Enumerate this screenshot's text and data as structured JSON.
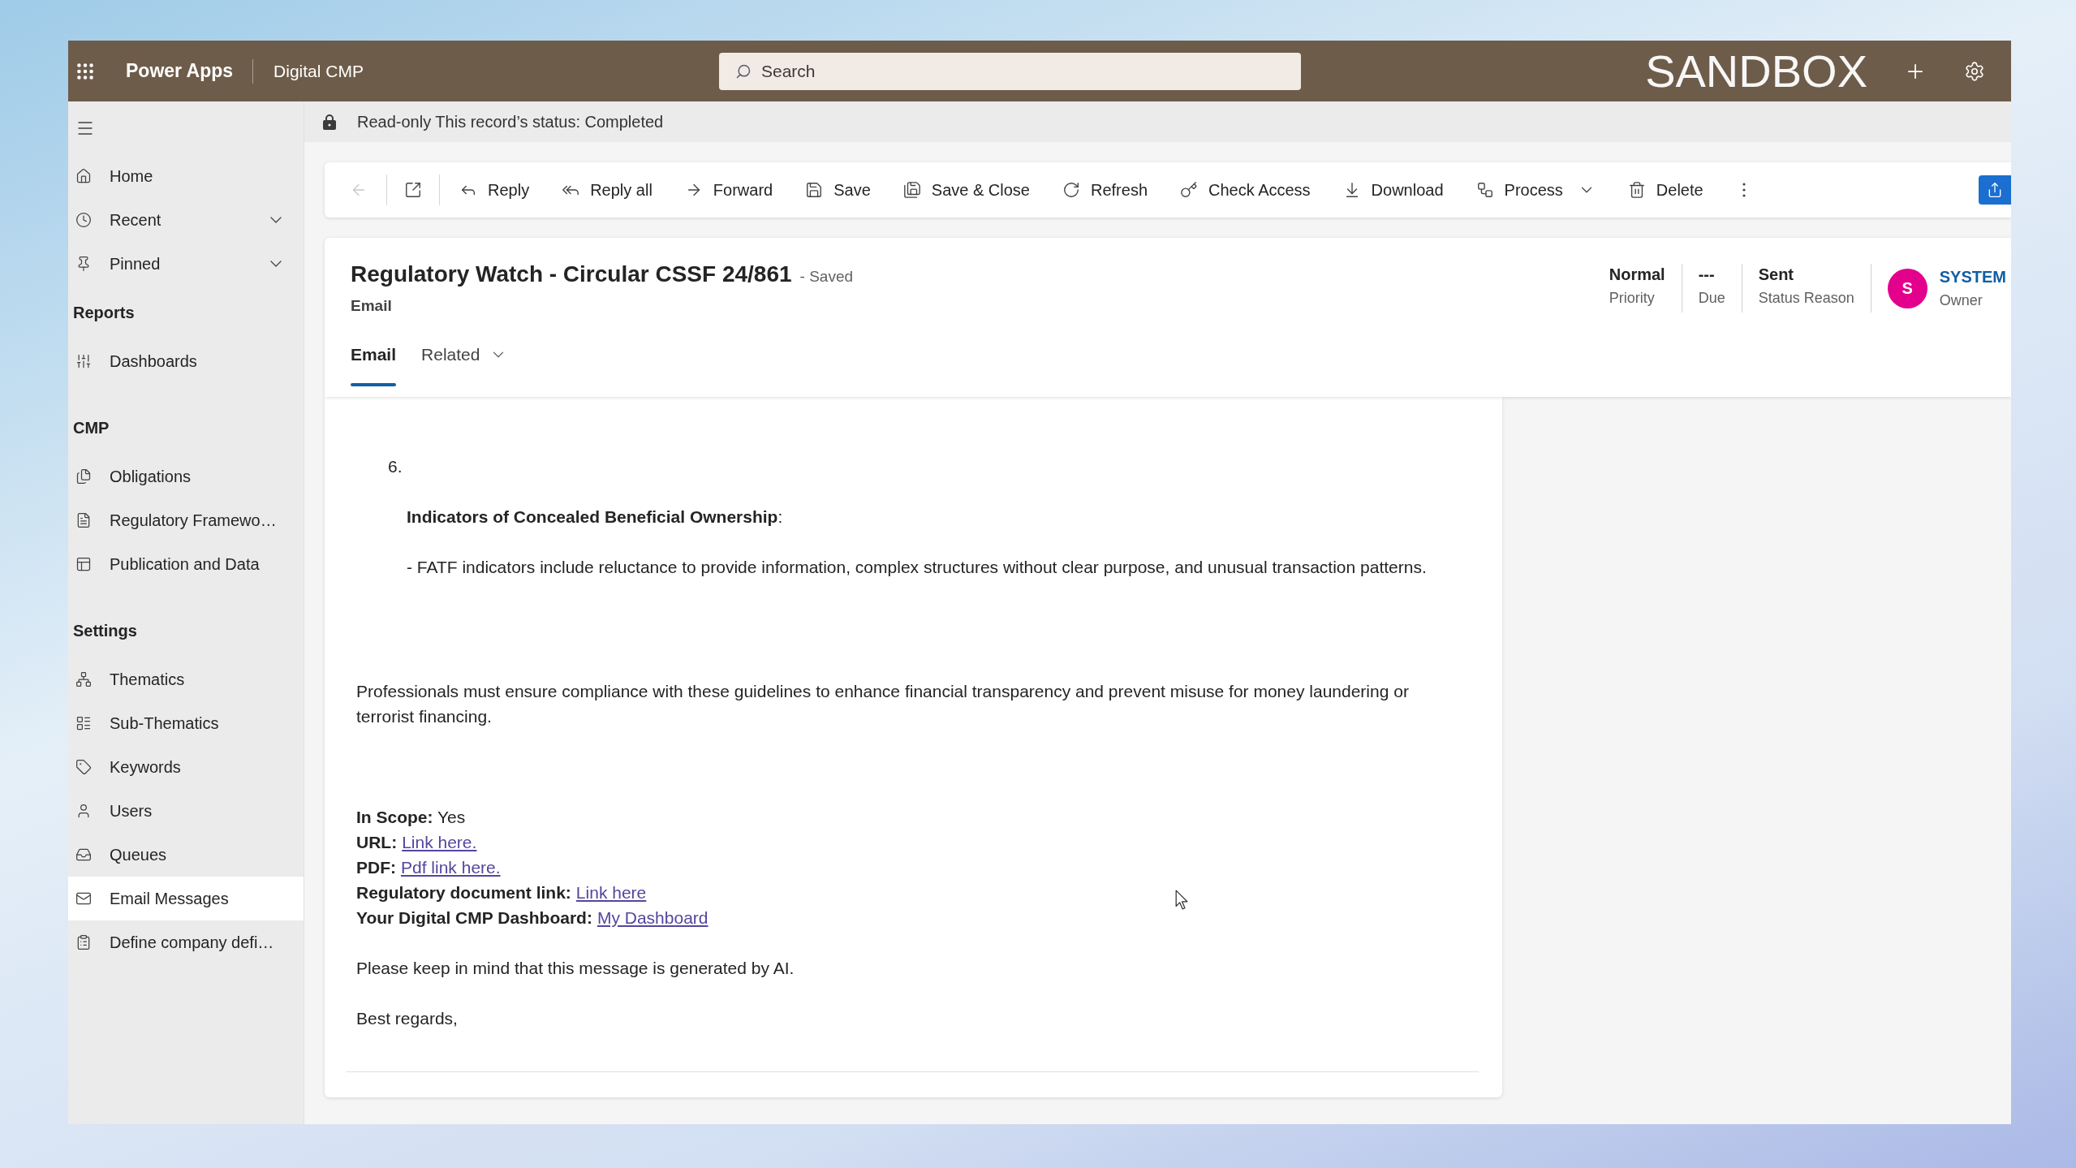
{
  "top_bar": {
    "app_name": "Power Apps",
    "app_title": "Digital CMP",
    "search": {
      "placeholder": "Search"
    },
    "environment": "SANDBOX"
  },
  "sidebar": {
    "top_items": [
      {
        "kind": "link",
        "label": "Home",
        "selected": false
      },
      {
        "kind": "group",
        "label": "Recent",
        "selected": false,
        "expanded": false
      },
      {
        "kind": "group",
        "label": "Pinned",
        "selected": false,
        "expanded": false
      }
    ],
    "sections": [
      {
        "title": "Reports",
        "items": [
          {
            "label": "Dashboards",
            "selected": false
          }
        ]
      },
      {
        "title": "CMP",
        "items": [
          {
            "label": "Obligations",
            "selected": false
          },
          {
            "label": "Regulatory Framewo…",
            "selected": false
          },
          {
            "label": "Publication and Data",
            "selected": false
          }
        ]
      },
      {
        "title": "Settings",
        "items": [
          {
            "label": "Thematics",
            "selected": false
          },
          {
            "label": "Sub-Thematics",
            "selected": false
          },
          {
            "label": "Keywords",
            "selected": false
          },
          {
            "label": "Users",
            "selected": false
          },
          {
            "label": "Queues",
            "selected": false
          },
          {
            "label": "Email Messages",
            "selected": true
          },
          {
            "label": "Define company defi…",
            "selected": false
          }
        ]
      }
    ]
  },
  "notification": {
    "text": "Read-only This record’s status: Completed"
  },
  "toolbar": {
    "back": {
      "disabled": true
    },
    "commands": [
      {
        "kind": "button",
        "label": "Reply"
      },
      {
        "kind": "button",
        "label": "Reply all"
      },
      {
        "kind": "button",
        "label": "Forward"
      },
      {
        "kind": "button",
        "label": "Save"
      },
      {
        "kind": "button",
        "label": "Save & Close"
      },
      {
        "kind": "button",
        "label": "Refresh"
      },
      {
        "kind": "button",
        "label": "Check Access"
      },
      {
        "kind": "button",
        "label": "Download"
      },
      {
        "kind": "dropdown",
        "label": "Process"
      },
      {
        "kind": "button",
        "label": "Delete"
      }
    ]
  },
  "record": {
    "title": "Regulatory Watch - Circular CSSF 24/861",
    "save_status": "- Saved",
    "entity": "Email",
    "tabs": [
      {
        "kind": "tab",
        "label": "Email",
        "selected": true
      },
      {
        "kind": "menu",
        "label": "Related",
        "selected": false
      }
    ],
    "fields": [
      {
        "value": "Normal",
        "label": "Priority"
      },
      {
        "value": "---",
        "label": "Due"
      },
      {
        "value": "Sent",
        "label": "Status Reason"
      }
    ],
    "owner": {
      "initial": "S",
      "name": "SYSTEM",
      "label": "Owner"
    }
  },
  "email_body": {
    "blocks": [
      {
        "kind": "list_number",
        "text": "6."
      },
      {
        "kind": "heading",
        "text": "**Indicators of Concealed Beneficial Ownership**:"
      },
      {
        "kind": "bullet",
        "text": "- FATF indicators include reluctance to provide information, complex structures without clear purpose, and unusual transaction patterns."
      },
      {
        "kind": "paragraph",
        "text": "Professionals must ensure compliance with these guidelines to enhance financial transparency and prevent misuse for money laundering or terrorist financing."
      },
      {
        "kind": "fields",
        "lines": [
          {
            "kind": "text",
            "text": "**In Scope:** Yes"
          },
          {
            "kind": "link",
            "label": "URL:",
            "link": "Link here."
          },
          {
            "kind": "link",
            "label": "PDF:",
            "link": "Pdf link here."
          },
          {
            "kind": "link",
            "label": "Regulatory document link:",
            "link": "Link here"
          },
          {
            "kind": "link",
            "label": "Your Digital CMP Dashboard:",
            "link": "My Dashboard"
          }
        ]
      },
      {
        "kind": "paragraph",
        "text": "Please keep in mind that this message is generated by AI."
      },
      {
        "kind": "paragraph",
        "text": "Best regards,"
      }
    ]
  }
}
